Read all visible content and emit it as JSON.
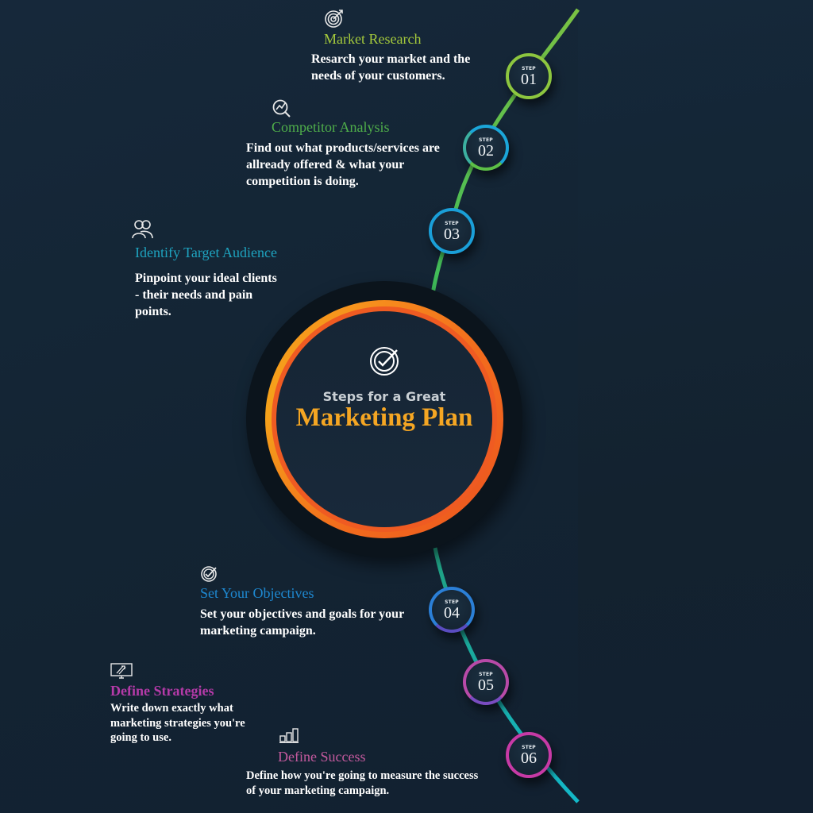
{
  "center": {
    "icon": "target-check-icon",
    "subtitle": "Steps for a Great",
    "title": "Marketing Plan",
    "title_color": "#f5a623",
    "ring_colors": [
      "#f5a21a",
      "#f26b1d"
    ]
  },
  "steps": [
    {
      "step_label": "STEP",
      "number": "01",
      "ring_color": "#8dc63f",
      "icon": "target-arrow-icon",
      "title": "Market Research",
      "title_color": "#a4c93c",
      "description": "Resarch your market and the needs of your customers."
    },
    {
      "step_label": "STEP",
      "number": "02",
      "ring_color": "#1ba6d9",
      "icon": "magnifier-chart-icon",
      "title": "Competitor Analysis",
      "title_color": "#4fae4a",
      "description": "Find out what products/services are allready offered & what your competition is doing."
    },
    {
      "step_label": "STEP",
      "number": "03",
      "ring_color": "#1a9fd8",
      "icon": "users-icon",
      "title": "Identify Target Audience",
      "title_color": "#1ea4c0",
      "description": "Pinpoint your ideal clients -  their needs and pain points."
    },
    {
      "step_label": "STEP",
      "number": "04",
      "ring_color": "#2b7fd6",
      "icon": "check-circle-icon",
      "title": "Set Your Objectives",
      "title_color": "#1e88d0",
      "description": "Set your objectives and goals for your marketing campaign."
    },
    {
      "step_label": "STEP",
      "number": "05",
      "ring_color": "#a44cb8",
      "icon": "monitor-strategy-icon",
      "title": "Define Strategies",
      "title_color": "#b43aa8",
      "description": "Write down exactly what marketing strategies you're going to use."
    },
    {
      "step_label": "STEP",
      "number": "06",
      "ring_color": "#c73aa6",
      "icon": "bar-chart-icon",
      "title": "Define Success",
      "title_color": "#c45a9e",
      "description": "Define how you're going to measure the success of your marketing campaign."
    }
  ]
}
